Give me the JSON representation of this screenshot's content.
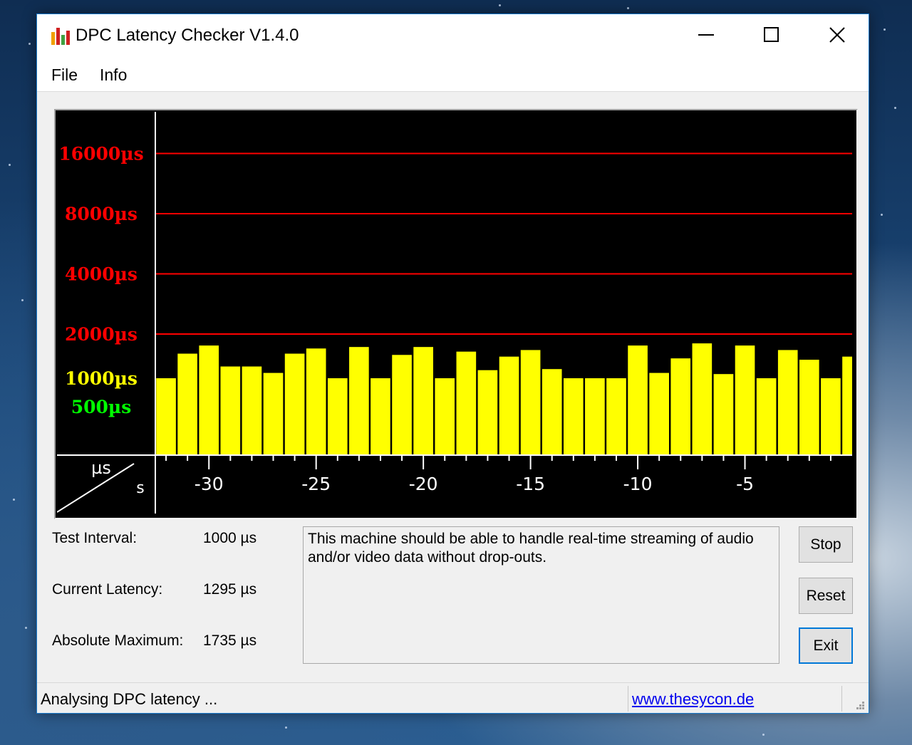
{
  "window": {
    "title": "DPC Latency Checker V1.4.0"
  },
  "menu": {
    "items": [
      "File",
      "Info"
    ]
  },
  "chart_data": {
    "type": "bar",
    "y_labels": [
      {
        "text": "16000µs",
        "value": 16000,
        "color": "#ff0000",
        "gridline": true
      },
      {
        "text": "8000µs",
        "value": 8000,
        "color": "#ff0000",
        "gridline": true
      },
      {
        "text": "4000µs",
        "value": 4000,
        "color": "#ff0000",
        "gridline": true
      },
      {
        "text": "2000µs",
        "value": 2000,
        "color": "#ff0000",
        "gridline": true
      },
      {
        "text": "1000µs",
        "value": 1000,
        "color": "#ffff00",
        "gridline": false
      },
      {
        "text": "500µs",
        "value": 500,
        "color": "#00ff00",
        "gridline": false
      }
    ],
    "x_tick_labels": [
      "-30",
      "-25",
      "-20",
      "-15",
      "-10",
      "-5"
    ],
    "x_tick_values": [
      -30,
      -25,
      -20,
      -15,
      -10,
      -5
    ],
    "x_range": [
      -32.5,
      0
    ],
    "corner_y_unit": "µs",
    "corner_x_unit": "s",
    "bar_color": "#ffff00",
    "gridline_color": "#ff0000",
    "values": [
      1000,
      1490,
      1700,
      1210,
      1210,
      1090,
      1490,
      1620,
      1000,
      1660,
      1000,
      1460,
      1660,
      1000,
      1540,
      1140,
      1420,
      1580,
      1160,
      1000,
      1000,
      1000,
      1700,
      1090,
      1380,
      1760,
      1070,
      1700,
      1000,
      1580,
      1350,
      1000,
      1420
    ]
  },
  "stats": {
    "test_interval_label": "Test Interval:",
    "test_interval_value": "1000 µs",
    "current_latency_label": "Current Latency:",
    "current_latency_value": "1295 µs",
    "absolute_maximum_label": "Absolute Maximum:",
    "absolute_maximum_value": "1735 µs"
  },
  "message": "This machine should be able to handle real-time streaming of audio and/or video data without drop-outs.",
  "buttons": {
    "stop": "Stop",
    "reset": "Reset",
    "exit": "Exit"
  },
  "status": {
    "text": "Analysing DPC latency ...",
    "link": "www.thesycon.de"
  }
}
